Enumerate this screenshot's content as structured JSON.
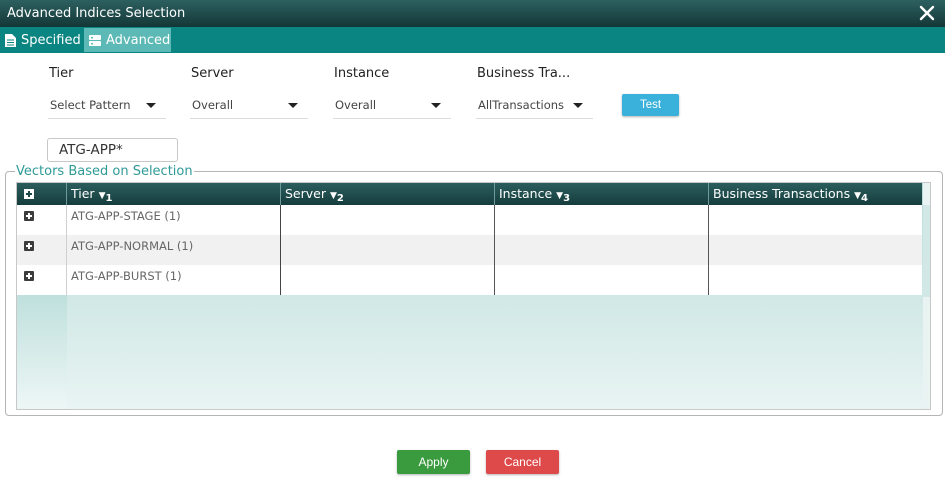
{
  "window": {
    "title": "Advanced Indices Selection"
  },
  "tabs": [
    {
      "label": "Specified",
      "icon": "document-icon"
    },
    {
      "label": "Advanced",
      "icon": "server-icon",
      "active": true
    }
  ],
  "filters": {
    "tier": {
      "label": "Tier",
      "value": "Select Pattern"
    },
    "server": {
      "label": "Server",
      "value": "Overall"
    },
    "instance": {
      "label": "Instance",
      "value": "Overall"
    },
    "business": {
      "label": "Business Tra...",
      "value": "AllTransactions"
    }
  },
  "test_label": "Test",
  "pattern_value": "ATG-APP*",
  "vectors": {
    "legend": "Vectors Based on Selection",
    "columns": [
      {
        "label": "Tier",
        "order": "1"
      },
      {
        "label": "Server",
        "order": "2"
      },
      {
        "label": "Instance",
        "order": "3"
      },
      {
        "label": "Business Transactions",
        "order": "4"
      }
    ],
    "rows": [
      {
        "tier": "ATG-APP-STAGE (1)",
        "server": "",
        "instance": "",
        "business": ""
      },
      {
        "tier": "ATG-APP-NORMAL (1)",
        "server": "",
        "instance": "",
        "business": ""
      },
      {
        "tier": "ATG-APP-BURST (1)",
        "server": "",
        "instance": "",
        "business": ""
      }
    ]
  },
  "actions": {
    "apply": "Apply",
    "cancel": "Cancel"
  },
  "colors": {
    "header": "#143737",
    "tabbar": "#0b8581",
    "active_tab": "#5db9b5",
    "test": "#3ab1da",
    "apply": "#3a9a3e",
    "cancel": "#de4a4a",
    "legend": "#2e9a96"
  }
}
